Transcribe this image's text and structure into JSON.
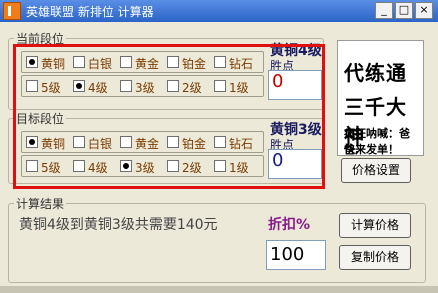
{
  "window": {
    "title": "英雄联盟 新排位 计算器"
  },
  "current": {
    "group_label": "当前段位",
    "tiers": [
      {
        "label": "黄铜",
        "checked": true
      },
      {
        "label": "白银",
        "checked": false
      },
      {
        "label": "黄金",
        "checked": false
      },
      {
        "label": "铂金",
        "checked": false
      },
      {
        "label": "钻石",
        "checked": false
      }
    ],
    "levels": [
      {
        "label": "5级",
        "checked": false
      },
      {
        "label": "4级",
        "checked": true
      },
      {
        "label": "3级",
        "checked": false
      },
      {
        "label": "2级",
        "checked": false
      },
      {
        "label": "1级",
        "checked": false
      }
    ],
    "rank_display": "黄铜4级",
    "points_label": "胜点",
    "points_value": "0"
  },
  "target": {
    "group_label": "目标段位",
    "tiers": [
      {
        "label": "黄铜",
        "checked": true
      },
      {
        "label": "白银",
        "checked": false
      },
      {
        "label": "黄金",
        "checked": false
      },
      {
        "label": "铂金",
        "checked": false
      },
      {
        "label": "钻石",
        "checked": false
      }
    ],
    "levels": [
      {
        "label": "5级",
        "checked": false
      },
      {
        "label": "4级",
        "checked": false
      },
      {
        "label": "3级",
        "checked": true
      },
      {
        "label": "2级",
        "checked": false
      },
      {
        "label": "1级",
        "checked": false
      }
    ],
    "rank_display": "黄铜3级",
    "points_label": "胜点",
    "points_value": "0"
  },
  "ad": {
    "line1": "代练通",
    "line2": "三千大神",
    "line3": "疯狂呐喊：爸爸,",
    "line4": "快来发单！"
  },
  "buttons": {
    "price_settings": "价格设置",
    "calculate": "计算价格",
    "copy": "复制价格"
  },
  "result": {
    "group_label": "计算结果",
    "text": "黄铜4级到黄铜3级共需要140元",
    "discount_label": "折扣%",
    "discount_value": "100"
  }
}
